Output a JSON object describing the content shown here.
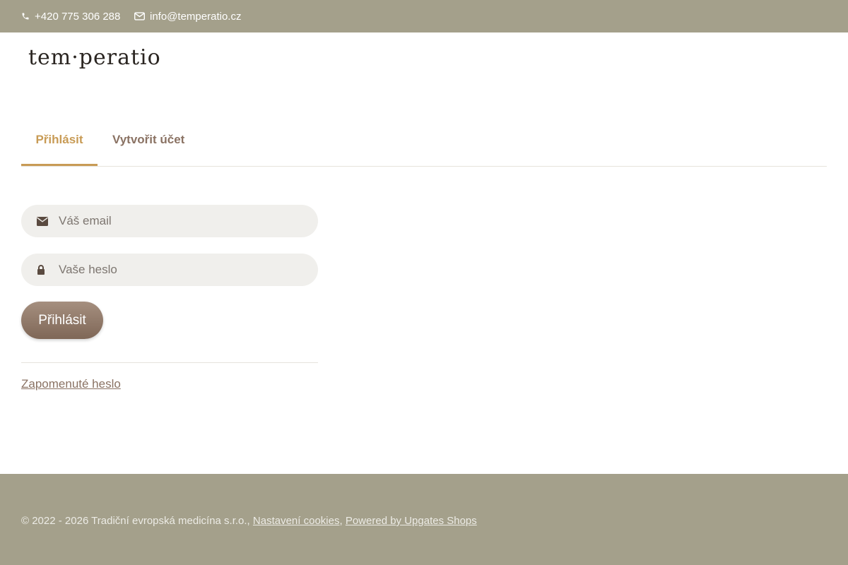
{
  "topbar": {
    "phone": "+420 775 306 288",
    "email": "info@temperatio.cz",
    "phone_icon": "phone-icon",
    "email_icon": "envelope-icon"
  },
  "logo": {
    "text": "tem·peratio"
  },
  "tabs": [
    {
      "label": "Přihlásit",
      "active": true
    },
    {
      "label": "Vytvořit účet",
      "active": false
    }
  ],
  "form": {
    "email_placeholder": "Váš email",
    "email_value": "",
    "email_icon": "envelope-icon",
    "password_placeholder": "Vaše heslo",
    "password_value": "",
    "password_icon": "lock-icon",
    "submit_label": "Přihlásit",
    "forgot_label": "Zapomenuté heslo"
  },
  "footer": {
    "copyright": "© 2022 - 2026 Tradiční evropská medicína s.r.o.,",
    "cookies_label": "Nastavení cookies",
    "separator": ",",
    "powered_label": "Powered by Upgates Shops"
  },
  "colors": {
    "bar_background": "#a4a08b",
    "accent": "#c89b55",
    "tab_inactive": "#8a7263",
    "button_gradient_top": "#a58f7f",
    "button_gradient_bottom": "#7f6757",
    "field_background": "#f0efec"
  }
}
